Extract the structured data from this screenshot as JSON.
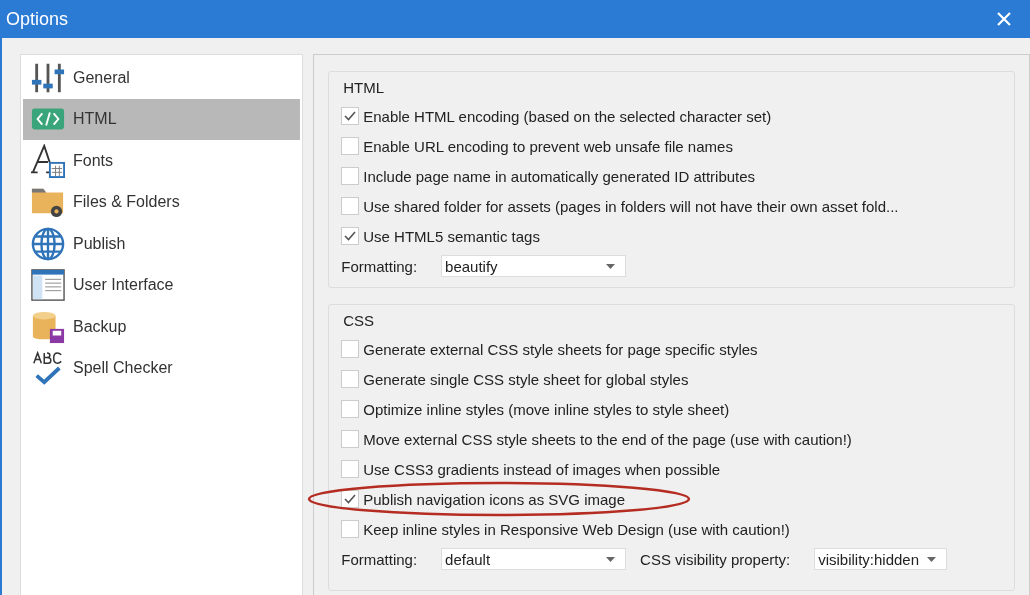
{
  "window": {
    "title": "Options"
  },
  "sidebar": {
    "items": [
      {
        "label": "General",
        "selected": false
      },
      {
        "label": "HTML",
        "selected": true
      },
      {
        "label": "Fonts",
        "selected": false
      },
      {
        "label": "Files & Folders",
        "selected": false
      },
      {
        "label": "Publish",
        "selected": false
      },
      {
        "label": "User Interface",
        "selected": false
      },
      {
        "label": "Backup",
        "selected": false
      },
      {
        "label": "Spell Checker",
        "selected": false
      }
    ]
  },
  "groups": [
    {
      "title": "HTML",
      "options": [
        {
          "label": "Enable HTML encoding (based on the selected character set)",
          "checked": true,
          "highlighted": false
        },
        {
          "label": "Enable URL encoding to prevent web unsafe file names",
          "checked": false,
          "highlighted": false
        },
        {
          "label": "Include page name in automatically generated ID attributes",
          "checked": false,
          "highlighted": false
        },
        {
          "label": "Use shared folder for assets (pages in folders will not have their own asset fold...",
          "checked": false,
          "highlighted": false
        },
        {
          "label": "Use HTML5 semantic tags",
          "checked": true,
          "highlighted": false
        }
      ],
      "dropdowns": [
        {
          "label": "Formatting:",
          "value": "beautify"
        }
      ]
    },
    {
      "title": "CSS",
      "options": [
        {
          "label": "Generate external CSS style sheets for page specific styles",
          "checked": false,
          "highlighted": false
        },
        {
          "label": "Generate single CSS style sheet for global styles",
          "checked": false,
          "highlighted": false
        },
        {
          "label": "Optimize inline styles (move inline styles to style sheet)",
          "checked": false,
          "highlighted": false
        },
        {
          "label": "Move external CSS style sheets to the end of the page (use with caution!)",
          "checked": false,
          "highlighted": false
        },
        {
          "label": "Use CSS3 gradients instead of images when possible",
          "checked": false,
          "highlighted": false
        },
        {
          "label": "Publish navigation icons as SVG image",
          "checked": true,
          "highlighted": true
        },
        {
          "label": "Keep inline styles in Responsive Web Design (use with caution!)",
          "checked": false,
          "highlighted": false
        }
      ],
      "dropdowns": [
        {
          "label": "Formatting:",
          "value": "default"
        },
        {
          "label": "CSS visibility property:",
          "value": "visibility:hidden"
        }
      ]
    }
  ]
}
